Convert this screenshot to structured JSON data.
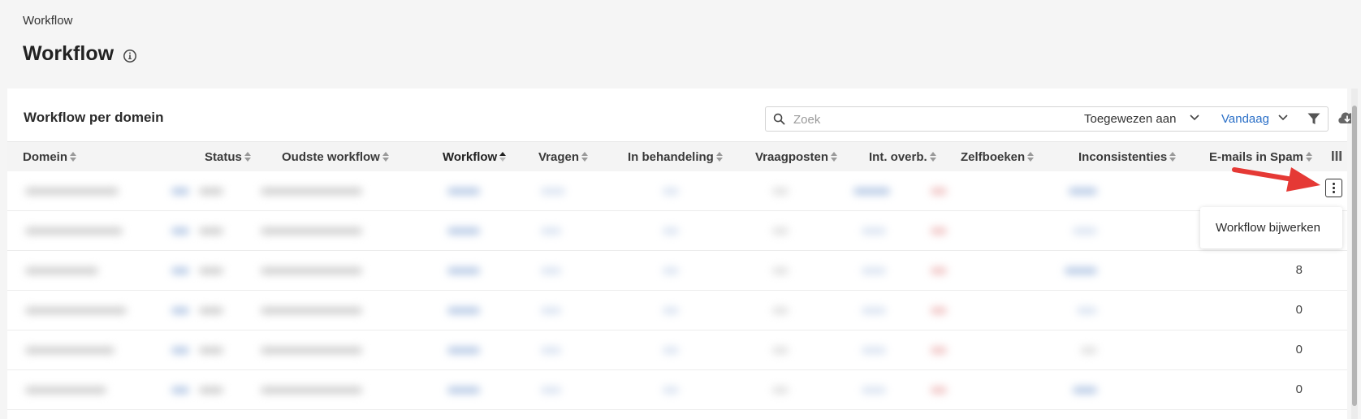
{
  "breadcrumb": "Workflow",
  "page_title": "Workflow",
  "card": {
    "title": "Workflow per domein",
    "search_placeholder": "Zoek",
    "assignee_label": "Toegewezen aan",
    "date_label": "Vandaag"
  },
  "table": {
    "columns": [
      {
        "label": "Domein"
      },
      {
        "label": "Status"
      },
      {
        "label": "Oudste workflow"
      },
      {
        "label": "Workflow"
      },
      {
        "label": "Vragen"
      },
      {
        "label": "In behandeling"
      },
      {
        "label": "Vraagposten"
      },
      {
        "label": "Int. overb."
      },
      {
        "label": "Zelfboeken"
      },
      {
        "label": "Inconsistenties"
      },
      {
        "label": "E-mails in Spam"
      }
    ],
    "sorted_column": "Workflow",
    "spam_values": [
      "",
      "",
      "8",
      "0",
      "0",
      "0"
    ]
  },
  "row_menu": {
    "item": "Workflow bijwerken"
  },
  "colors": {
    "accent_blue": "#2a6fc7",
    "annotation_arrow": "#e53935"
  },
  "icons": [
    "info-icon",
    "search-icon",
    "chevron-down-icon",
    "filter-icon",
    "cloud-download-icon",
    "sort-icon",
    "columns-icon",
    "kebab-menu-icon"
  ]
}
